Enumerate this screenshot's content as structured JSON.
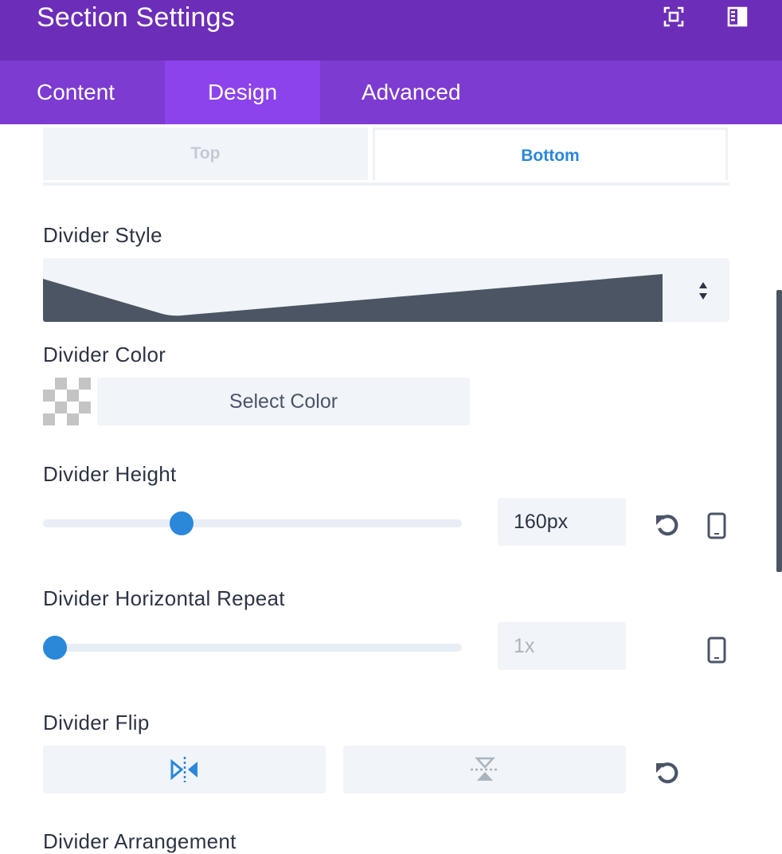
{
  "header": {
    "title": "Section Settings"
  },
  "tabs": [
    {
      "label": "Content",
      "active": false
    },
    {
      "label": "Design",
      "active": true
    },
    {
      "label": "Advanced",
      "active": false
    }
  ],
  "divider_position": {
    "top_label": "Top",
    "bottom_label": "Bottom",
    "selected": "Bottom"
  },
  "divider_style": {
    "label": "Divider Style"
  },
  "divider_color": {
    "label": "Divider Color",
    "button_label": "Select Color"
  },
  "divider_height": {
    "label": "Divider Height",
    "value": "160px",
    "slider_fraction": 0.33
  },
  "divider_repeat": {
    "label": "Divider Horizontal Repeat",
    "value": "1x",
    "slider_fraction": 0.0
  },
  "divider_flip": {
    "label": "Divider Flip"
  },
  "divider_arrangement": {
    "label": "Divider Arrangement"
  },
  "colors": {
    "header_bg": "#6c2eb9",
    "tabs_bg": "#7d3bd1",
    "active_tab_bg": "#8c43ec",
    "accent": "#2b87da",
    "divider_shape": "#4b5563"
  }
}
